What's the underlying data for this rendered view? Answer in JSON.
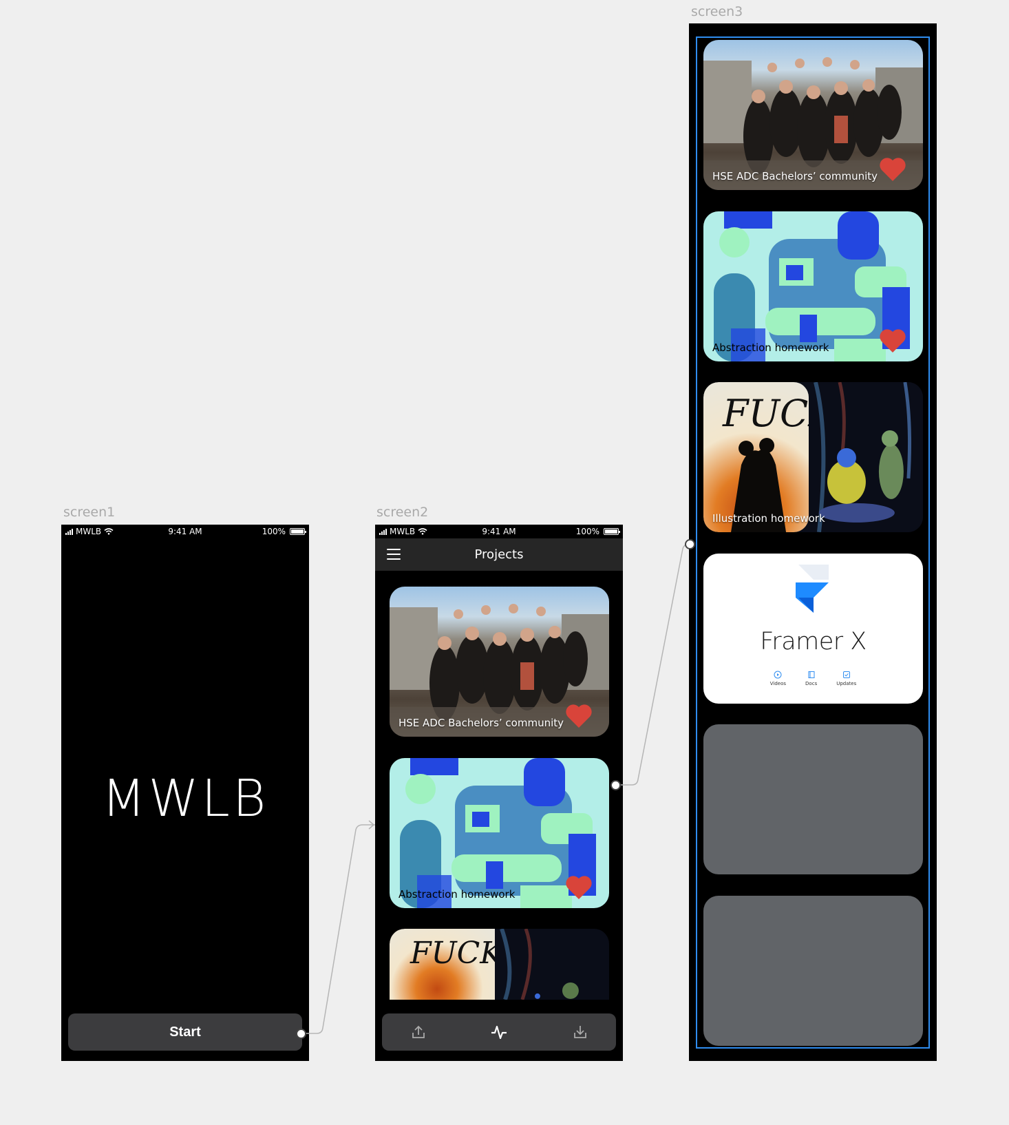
{
  "frames": {
    "screen1": "screen1",
    "screen2": "screen2",
    "screen3": "screen3"
  },
  "status_bar": {
    "carrier": "MWLB",
    "time": "9:41 AM",
    "battery": "100%"
  },
  "screen1": {
    "logo": "MWLB",
    "start_label": "Start"
  },
  "screen2": {
    "nav_title": "Projects",
    "cards": [
      {
        "caption": "HSE ADC Bachelors’ community"
      },
      {
        "caption": "Abstraction homework"
      }
    ],
    "illus_text": "FUCK",
    "tabbar": {
      "icons": [
        "upload-icon",
        "activity-icon",
        "download-icon"
      ]
    }
  },
  "screen3": {
    "cards": [
      {
        "caption": "HSE ADC Bachelors’ community"
      },
      {
        "caption": "Abstraction homework"
      },
      {
        "caption": "Illustration homework",
        "illus_text": "FUCK"
      },
      {
        "title": "Framer X",
        "links": [
          "Videos",
          "Docs",
          "Updates"
        ]
      }
    ]
  },
  "colors": {
    "heart": "#d9443a",
    "tabbar": "#3c3c3e",
    "navbar": "#262626",
    "placeholder_card": "#616468",
    "selection": "#2f8df0"
  }
}
